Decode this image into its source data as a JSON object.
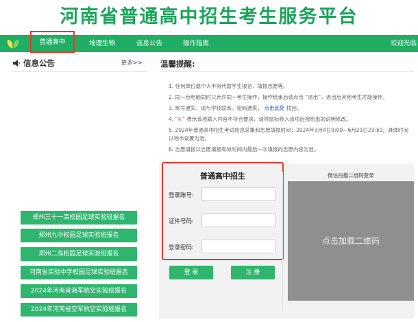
{
  "site": {
    "title": "河南省普通高中招生考生服务平台"
  },
  "nav": {
    "items": [
      {
        "label": "普通高中",
        "active": true
      },
      {
        "label": "地理生物",
        "active": false
      },
      {
        "label": "信息公告",
        "active": false
      },
      {
        "label": "操作指南",
        "active": false
      }
    ],
    "welcome": "欢迎光临",
    "accent_color": "#1fae64",
    "highlight_color": "#e8382d"
  },
  "notice": {
    "title": "信息公告",
    "more": "更多>>"
  },
  "side_buttons": [
    "郑州三十一高校园足球实验班报名",
    "郑州九中校园足球实验班报名",
    "郑州二高校园足球实验班报名",
    "河南省实验中学校园足球实验班报名",
    "2024年河南省海军航空实验班报名",
    "2024年河南省空军航空实验班报名"
  ],
  "tips": {
    "title": "温馨提醒:",
    "items": [
      "1. 任何单位或个人不得代替学生报名、填报志愿等。",
      "2. 同一台电脑同时只允许同一考生操作，操作结束后请点击 “退出”，退出后其他考生才能操作。",
      {
        "before": "3. 账号遗失，请与学校联系。密码遗失，",
        "link": "点击此处",
        "after": "找回。"
      },
      {
        "before": "4. ",
        "mark": "“①”",
        "after": "表示该项输入内容不符合要求，请将鼠标移入该项后按给出的说明修改。"
      },
      "5. 2024年普通高中招生考试信息采集和志愿填报时间：2024年3月4日9:00—6月21日23:59。具体时间以地市设置为准。",
      "6. 志愿填报以志愿填报有效时间内最后一次填报的志愿内容为准。"
    ]
  },
  "login": {
    "title": "普通高中招生",
    "account_label": "登录账号:",
    "idcard_label": "证件号码:",
    "password_label": "登录密码:",
    "account_value": "",
    "idcard_value": "",
    "password_value": "",
    "login_button": "登 录",
    "register_button": "注 册"
  },
  "qr": {
    "title": "微信扫描二维码登录",
    "placeholder": "点击加载二维码"
  }
}
